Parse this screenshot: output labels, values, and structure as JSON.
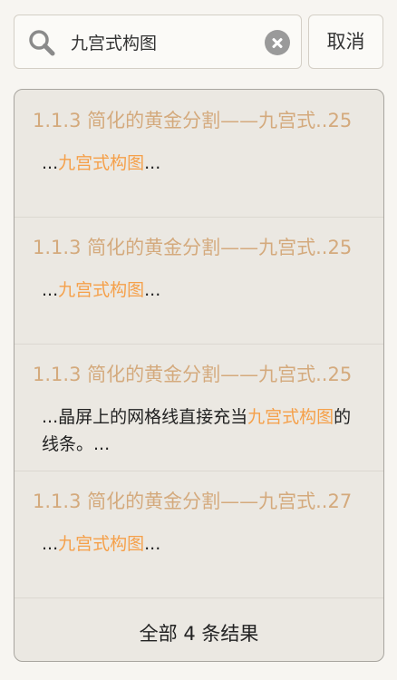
{
  "search": {
    "query": "九宫式构图",
    "cancel_label": "取消"
  },
  "results": [
    {
      "title": "1.1.3 简化的黄金分割——九宫式..25",
      "snippet_pre": "...",
      "snippet_highlight": "九宫式构图",
      "snippet_post": "..."
    },
    {
      "title": "1.1.3 简化的黄金分割——九宫式..25",
      "snippet_pre": "...",
      "snippet_highlight": "九宫式构图",
      "snippet_post": "..."
    },
    {
      "title": "1.1.3 简化的黄金分割——九宫式..25",
      "snippet_pre": "...晶屏上的网格线直接充当",
      "snippet_highlight": "九宫式构图",
      "snippet_post": "的线条。..."
    },
    {
      "title": "1.1.3 简化的黄金分割——九宫式..27",
      "snippet_pre": "...",
      "snippet_highlight": "九宫式构图",
      "snippet_post": "..."
    }
  ],
  "results_count": "全部 4 条结果",
  "colors": {
    "title": "#d4aa7d",
    "highlight": "#f5a04a",
    "panel_bg": "#ebe8e2"
  },
  "icons": {
    "search": "search-icon",
    "clear": "clear-icon"
  }
}
